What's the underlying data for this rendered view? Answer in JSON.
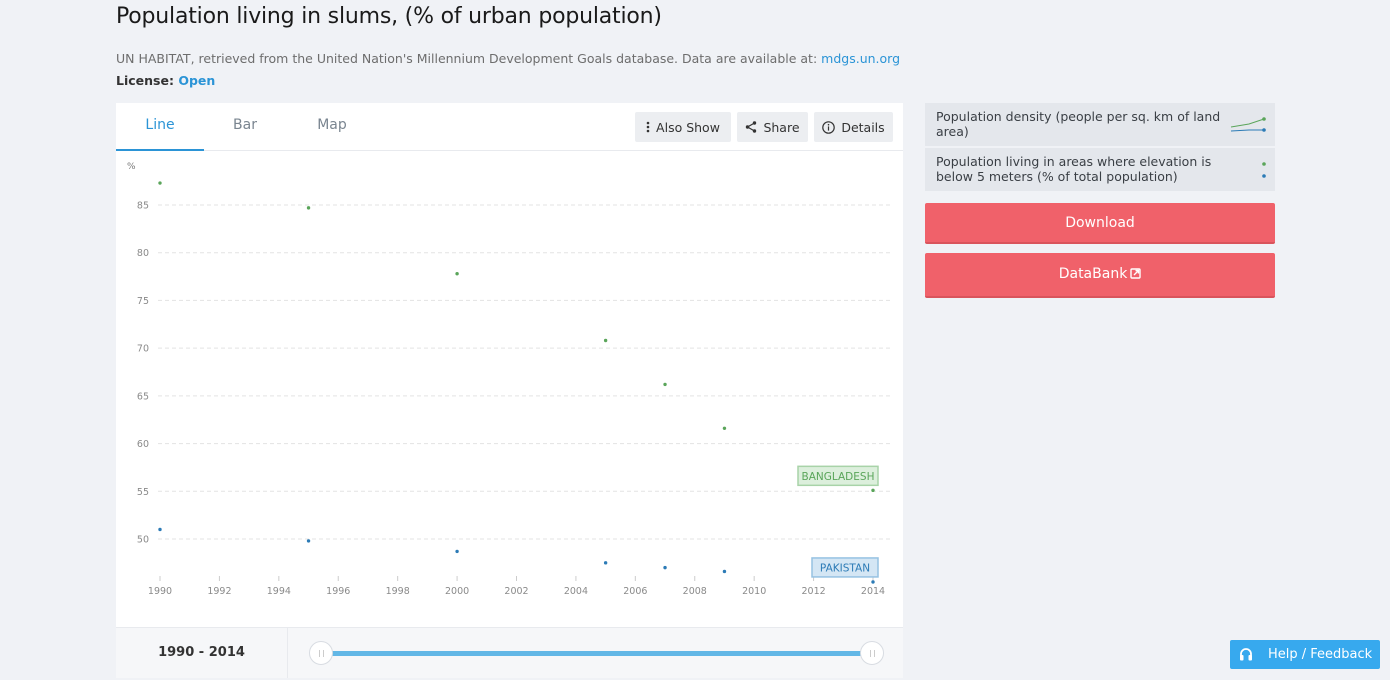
{
  "header": {
    "title": "Population living in slums, (% of urban population)",
    "source_text": "UN HABITAT, retrieved from the United Nation's Millennium Development Goals database. Data are available at: ",
    "source_link": "mdgs.un.org",
    "license_label": "License: ",
    "license_value": "Open"
  },
  "tabs": [
    {
      "label": "Line",
      "active": true
    },
    {
      "label": "Bar",
      "active": false
    },
    {
      "label": "Map",
      "active": false
    }
  ],
  "toolbar": {
    "also_show": "Also Show",
    "share": "Share",
    "details": "Details"
  },
  "range": {
    "start": "1990",
    "separator": " - ",
    "end": "2014",
    "label": "1990 - 2014"
  },
  "side": {
    "also_show_items": [
      {
        "label": "Population density (people per sq. km of land area)",
        "icon": "mini-line-chart-icon"
      },
      {
        "label": "Population living in areas where elevation is below 5 meters (% of total population)",
        "icon": "mini-dot-chart-icon"
      }
    ],
    "download": "Download",
    "databank": "DataBank"
  },
  "help": {
    "label": "Help / Feedback",
    "icon": "headset-icon"
  },
  "colors": {
    "accent": "#2b94d6",
    "bangladesh": "#5aa55a",
    "pakistan": "#2c7bb6",
    "button_red": "#f0616a",
    "help_blue": "#37a9ee"
  },
  "chart_data": {
    "type": "scatter",
    "title": "Population living in slums, (% of urban population)",
    "ylabel": "%",
    "xlabel": "",
    "x_ticks": [
      1990,
      1992,
      1994,
      1996,
      1998,
      2000,
      2002,
      2004,
      2006,
      2008,
      2010,
      2012,
      2014
    ],
    "y_ticks": [
      50,
      55,
      60,
      65,
      70,
      75,
      80,
      85
    ],
    "xlim": [
      1990,
      2014
    ],
    "ylim": [
      45.3,
      89.4
    ],
    "grid": true,
    "series": [
      {
        "name": "BANGLADESH",
        "color": "#5aa55a",
        "label_bg": "#dcefdc",
        "label_border": "#a8d3a8",
        "x": [
          1990,
          1995,
          2000,
          2005,
          2007,
          2009,
          2014
        ],
        "values": [
          87.3,
          84.7,
          77.8,
          70.8,
          66.2,
          61.6,
          55.1
        ]
      },
      {
        "name": "PAKISTAN",
        "color": "#2c7bb6",
        "label_bg": "#d4e6f4",
        "label_border": "#96c2e2",
        "x": [
          1990,
          1995,
          2000,
          2005,
          2007,
          2009,
          2014
        ],
        "values": [
          51.0,
          49.8,
          48.7,
          47.5,
          47.0,
          46.6,
          45.5
        ]
      }
    ]
  }
}
